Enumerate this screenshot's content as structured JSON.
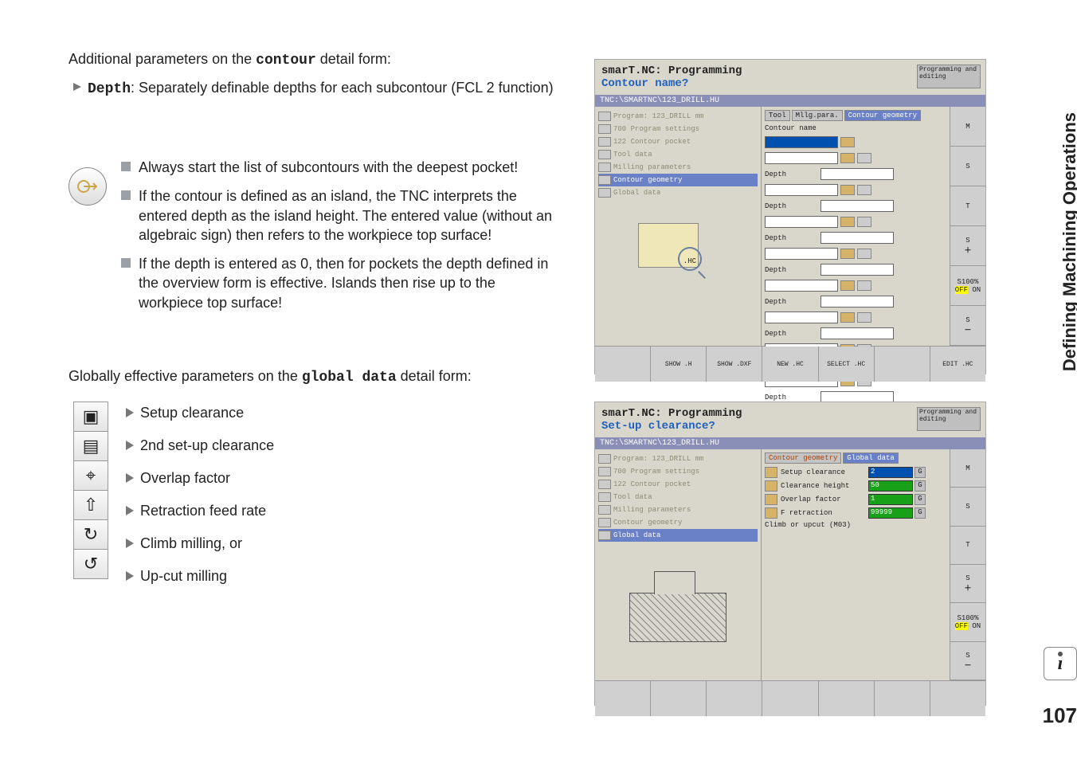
{
  "intro1_a": "Additional parameters on the ",
  "intro1_b": "contour",
  "intro1_c": " detail form:",
  "depth_label": "Depth",
  "depth_text": ": Separately definable depths for each subcontour (FCL 2 function)",
  "notes": {
    "n1": "Always start the list of subcontours with the deepest pocket!",
    "n2": "If the contour is defined as an island, the TNC interprets the entered depth as the island height. The entered value (without an algebraic sign) then refers to the workpiece top surface!",
    "n3": "If the depth is entered as 0, then for pockets the depth defined in the overview form is effective. Islands then rise up to the workpiece top surface!"
  },
  "global_a": "Globally effective parameters on the ",
  "global_b": "global data",
  "global_c": " detail form:",
  "params": {
    "p1": "Setup clearance",
    "p2": "2nd set-up clearance",
    "p3": "Overlap factor",
    "p4": "Retraction feed rate",
    "p5": "Climb milling, or",
    "p6": "Up-cut milling"
  },
  "icons": {
    "i1": "clearance-1-icon",
    "i2": "clearance-2-icon",
    "i3": "overlap-icon",
    "i4": "retraction-icon",
    "i5": "climb-icon",
    "i6": "upcut-icon"
  },
  "side_title": "Defining Machining Operations",
  "page_number": "107",
  "shot1": {
    "title": "smarT.NC: Programming",
    "question": "Contour name?",
    "mode": "Programming and editing",
    "path": "TNC:\\SMARTNC\\123_DRILL.HU",
    "tree": {
      "t0": "Program: 123_DRILL mm",
      "t1": "700 Program settings",
      "t2": "122 Contour pocket",
      "t3": "Tool data",
      "t4": "Milling parameters",
      "t5": "Contour geometry",
      "t6": "Global data"
    },
    "tabs": {
      "a": "Tool",
      "b": "Mllg.para.",
      "c": "Contour geometry"
    },
    "field_cn": "Contour name",
    "field_d": "Depth",
    "hc_label": ".HC",
    "sidebtn": {
      "m": "M",
      "s": "S",
      "t": "T",
      "s2": "S",
      "s100": "S100%",
      "off": "OFF",
      "on": "ON",
      "s3": "S"
    },
    "sk": {
      "k1": "SHOW .H",
      "k2": "SHOW .DXF",
      "k3": "NEW .HC",
      "k4": "SELECT .HC",
      "k5": "EDIT .HC"
    }
  },
  "shot2": {
    "title": "smarT.NC: Programming",
    "question": "Set-up clearance?",
    "mode": "Programming and editing",
    "path": "TNC:\\SMARTNC\\123_DRILL.HU",
    "tree": {
      "t0": "Program: 123_DRILL mm",
      "t1": "700 Program settings",
      "t2": "122 Contour pocket",
      "t3": "Tool data",
      "t4": "Milling parameters",
      "t5": "Contour geometry",
      "t6": "Global data"
    },
    "tabs": {
      "a": "Contour geometry",
      "b": "Global data"
    },
    "fields": {
      "f1": {
        "l": "Setup clearance",
        "v": "2",
        "u": "G"
      },
      "f2": {
        "l": "Clearance height",
        "v": "50",
        "u": "G"
      },
      "f3": {
        "l": "Overlap factor",
        "v": "1",
        "u": "G"
      },
      "f4": {
        "l": "F retraction",
        "v": "99999",
        "u": "G"
      },
      "f5": {
        "l": "Climb or upcut (M03)"
      }
    },
    "sidebtn": {
      "m": "M",
      "s": "S",
      "t": "T",
      "s2": "S",
      "s100": "S100%",
      "off": "OFF",
      "on": "ON",
      "s3": "S"
    }
  }
}
